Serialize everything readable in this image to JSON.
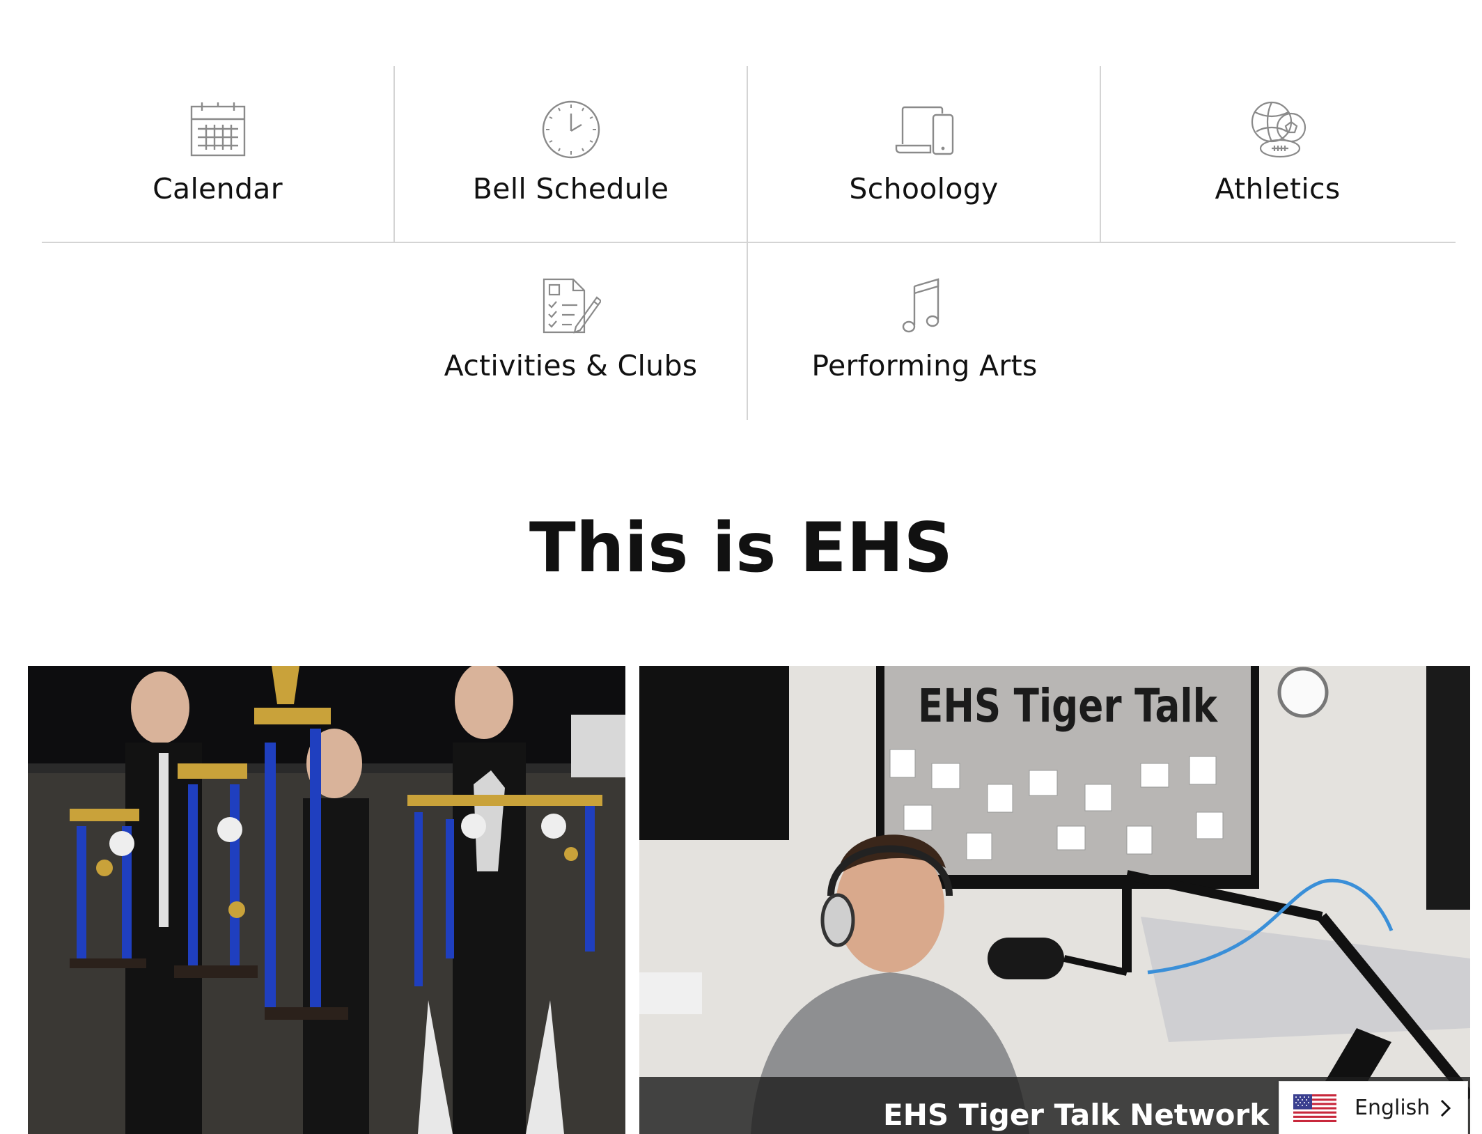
{
  "quick_links": [
    {
      "label": "Calendar",
      "icon": "calendar-icon"
    },
    {
      "label": "Bell Schedule",
      "icon": "clock-icon"
    },
    {
      "label": "Schoology",
      "icon": "devices-icon"
    },
    {
      "label": "Athletics",
      "icon": "sports-balls-icon"
    },
    {
      "label": "Activities & Clubs",
      "icon": "checklist-pencil-icon"
    },
    {
      "label": "Performing Arts",
      "icon": "music-note-icon"
    }
  ],
  "section": {
    "title": "This is EHS"
  },
  "cards": [
    {
      "image": "marching-band-trophies-photo",
      "caption": ""
    },
    {
      "image": "tiger-talk-podcast-studio-photo",
      "caption": "EHS Tiger Talk Network"
    }
  ],
  "photo_text": {
    "bulletin_board": "EHS Tiger Talk"
  },
  "language_selector": {
    "label": "English",
    "flag": "us-flag-icon"
  },
  "colors": {
    "divider": "#d4d4d4",
    "icon_stroke": "#8a8a8a",
    "caption_bg": "#1e1e1e"
  }
}
